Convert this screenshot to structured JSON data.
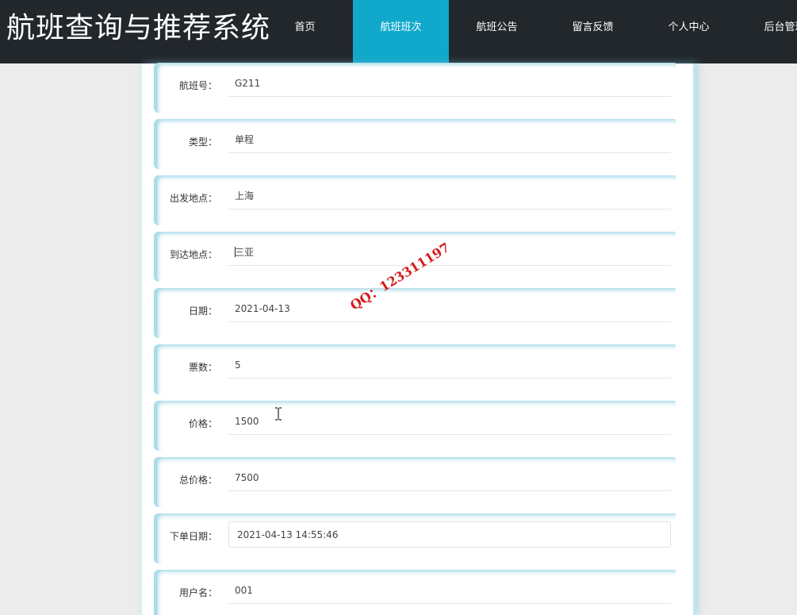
{
  "header": {
    "site_title": "航班查询与推荐系统",
    "nav": [
      {
        "label": "首页",
        "active": false
      },
      {
        "label": "航班班次",
        "active": true
      },
      {
        "label": "航班公告",
        "active": false
      },
      {
        "label": "留言反馈",
        "active": false
      },
      {
        "label": "个人中心",
        "active": false
      },
      {
        "label": "后台管理",
        "active": false
      }
    ],
    "active_color": "#10a9cc",
    "background_color": "#22272c"
  },
  "form": {
    "fields": [
      {
        "label": "航班号：",
        "value": "G211"
      },
      {
        "label": "类型：",
        "value": "单程"
      },
      {
        "label": "出发地点：",
        "value": "上海"
      },
      {
        "label": "到达地点：",
        "value": "三亚"
      },
      {
        "label": "日期：",
        "value": "2021-04-13"
      },
      {
        "label": "票数：",
        "value": "5"
      },
      {
        "label": "价格：",
        "value": "1500"
      },
      {
        "label": "总价格：",
        "value": "7500"
      },
      {
        "label": "下单日期：",
        "value": "2021-04-13 14:55:46"
      },
      {
        "label": "用户名：",
        "value": "001"
      }
    ]
  },
  "watermark": {
    "text": "QQ：123311197",
    "color": "#d41c1c"
  }
}
